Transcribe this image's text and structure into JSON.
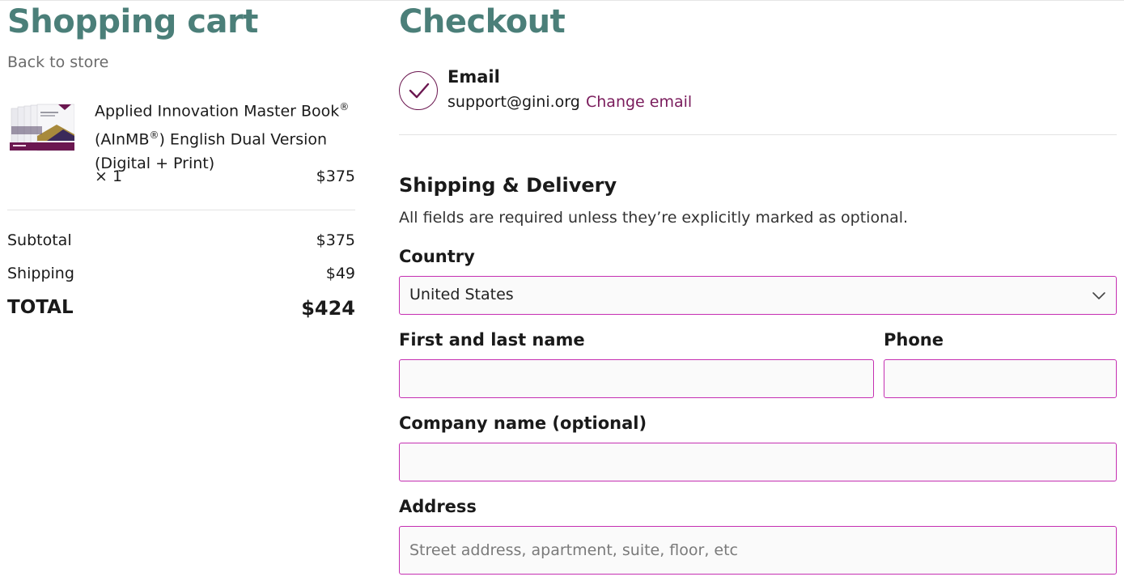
{
  "cart": {
    "title": "Shopping cart",
    "back_link": "Back to store",
    "item": {
      "name_line1": "Applied Innovation Master Book",
      "name_line2_a": "(AInMB",
      "name_line2_b": ") English Dual Version",
      "name_line3": "(Digital + Print)",
      "registered_mark": "®",
      "quantity": "× 1",
      "price": "$375",
      "thumbnail_icon": "book-cover-image"
    },
    "summary": {
      "subtotal_label": "Subtotal",
      "subtotal_value": "$375",
      "shipping_label": "Shipping",
      "shipping_value": "$49",
      "total_label": "TOTAL",
      "total_value": "$424"
    }
  },
  "checkout": {
    "title": "Checkout",
    "email": {
      "label": "Email",
      "value": "support@gini.org",
      "change_link": "Change email",
      "status_icon": "check-circle-icon"
    },
    "shipping": {
      "heading": "Shipping & Delivery",
      "note": "All fields are required unless they’re explicitly marked as optional.",
      "country_label": "Country",
      "country_value": "United States",
      "name_label": "First and last name",
      "name_value": "",
      "phone_label": "Phone",
      "phone_value": "",
      "company_label": "Company name (optional)",
      "company_value": "",
      "address_label": "Address",
      "address_placeholder": "Street address, apartment, suite, floor, etc",
      "address_value": ""
    }
  },
  "colors": {
    "heading_teal": "#4b7f79",
    "accent_plum": "#7a1c5c",
    "input_border": "#c52fb2"
  }
}
